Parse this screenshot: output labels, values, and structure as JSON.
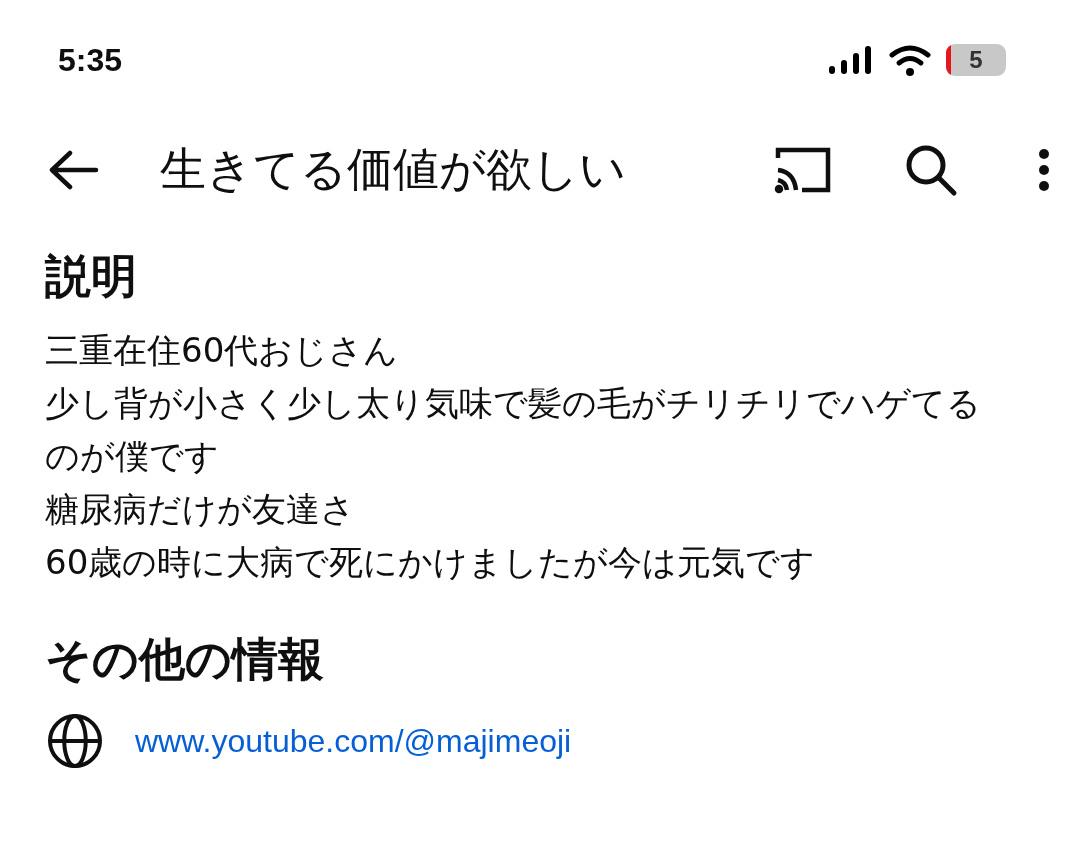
{
  "status_bar": {
    "time": "5:35",
    "battery": "5"
  },
  "header": {
    "title": "生きてる価値が欲しい"
  },
  "description": {
    "heading": "説明",
    "lines": [
      "三重在住60代おじさん",
      "少し背が小さく少し太り気味で髪の毛がチリチリでハゲてるのが僕です",
      "糖尿病だけが友達さ",
      "60歳の時に大病で死にかけましたが今は元気です"
    ]
  },
  "other_info": {
    "heading": "その他の情報",
    "links": [
      {
        "kind": "web",
        "text": "www.youtube.com/@majimeoji"
      }
    ]
  }
}
